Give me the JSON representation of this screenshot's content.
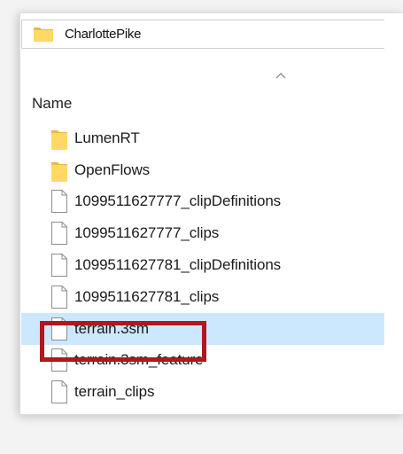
{
  "address_bar": {
    "path": "CharlottePike",
    "icon": "folder-icon"
  },
  "column_header": {
    "name_label": "Name",
    "sort_indicator": "sort-ascending-arrow-icon"
  },
  "files": [
    {
      "name": "LumenRT",
      "type": "folder",
      "icon": "folder-icon",
      "selected": false
    },
    {
      "name": "OpenFlows",
      "type": "folder",
      "icon": "folder-icon",
      "selected": false
    },
    {
      "name": "1099511627777_clipDefinitions",
      "type": "file",
      "icon": "file-icon",
      "selected": false
    },
    {
      "name": "1099511627777_clips",
      "type": "file",
      "icon": "file-icon",
      "selected": false
    },
    {
      "name": "1099511627781_clipDefinitions",
      "type": "file",
      "icon": "file-icon",
      "selected": false
    },
    {
      "name": "1099511627781_clips",
      "type": "file",
      "icon": "file-icon",
      "selected": false
    },
    {
      "name": "terrain.3sm",
      "type": "file",
      "icon": "file-icon",
      "selected": true
    },
    {
      "name": "terrain.3sm_feature",
      "type": "file",
      "icon": "file-icon",
      "selected": false
    },
    {
      "name": "terrain_clips",
      "type": "file",
      "icon": "file-icon",
      "selected": false
    }
  ],
  "colors": {
    "selection": "#cce8ff",
    "highlight_outline": "#b0171e",
    "folder_yellow": "#ffd866"
  }
}
